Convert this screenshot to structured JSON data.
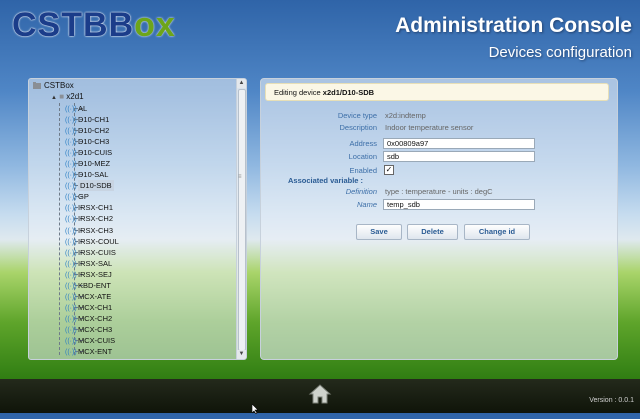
{
  "header": {
    "logo_part1": "CSTB",
    "logo_part2": "ox",
    "app_title": "Administration Console",
    "page_title": "Devices configuration"
  },
  "tree": {
    "root_label": "CSTBox",
    "node_label": "x2d1",
    "items": [
      "AL",
      "D10-CH1",
      "D10-CH2",
      "D10-CH3",
      "D10-CUIS",
      "D10-MEZ",
      "D10-SAL",
      "D10-SDB",
      "GP",
      "IRSX-CH1",
      "IRSX-CH2",
      "IRSX-CH3",
      "IRSX-COUL",
      "IRSX-CUIS",
      "IRSX-SAL",
      "IRSX-SEJ",
      "KBD-ENT",
      "MCX-ATE",
      "MCX-CH1",
      "MCX-CH2",
      "MCX-CH3",
      "MCX-CUIS",
      "MCX-ENT"
    ],
    "selected": "D10-SDB"
  },
  "editor": {
    "header_prefix": "Editing device ",
    "header_device": "x2d1/D10-SDB",
    "device_type_label": "Device type",
    "device_type_value": "x2d:indtemp",
    "description_label": "Description",
    "description_value": "Indoor temperature sensor",
    "address_label": "Address",
    "address_value": "0x00809a97",
    "location_label": "Location",
    "location_value": "sdb",
    "enabled_label": "Enabled",
    "enabled_checked": true,
    "assoc_label": "Associated variable :",
    "definition_label": "Definition",
    "definition_value": "type : temperature - units : degC",
    "name_label": "Name",
    "name_value": "temp_sdb",
    "save_label": "Save",
    "delete_label": "Delete",
    "change_id_label": "Change id"
  },
  "footer": {
    "version": "Version : 0.0.1"
  }
}
